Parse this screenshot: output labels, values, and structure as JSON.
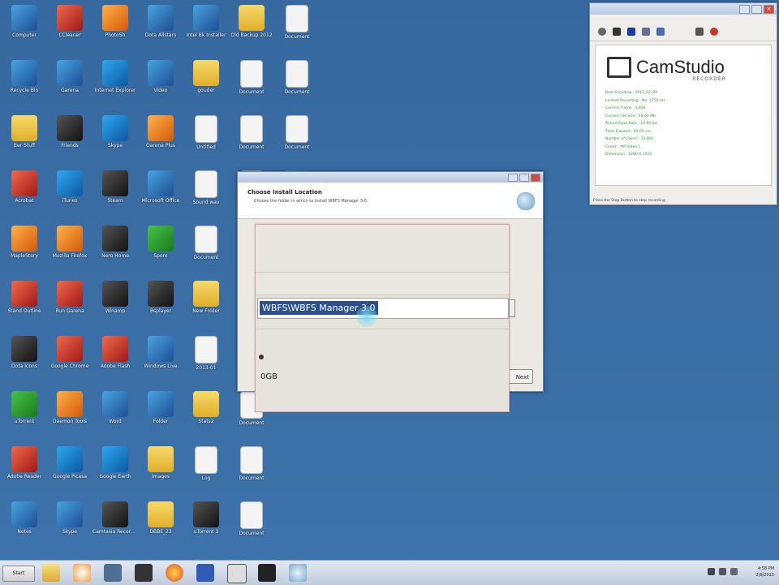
{
  "desktop": {
    "icons": [
      {
        "label": "Computer",
        "kind": "app"
      },
      {
        "label": "Recycle Bin",
        "kind": "app"
      },
      {
        "label": "Ber Stuff",
        "kind": "folder"
      },
      {
        "label": "Acrobat",
        "kind": "red"
      },
      {
        "label": "MapleStory",
        "kind": "orange"
      },
      {
        "label": "Stand Outline",
        "kind": "red"
      },
      {
        "label": "Dota Icons",
        "kind": "dark"
      },
      {
        "label": "uTorrent",
        "kind": "green"
      },
      {
        "label": "Adobe Reader",
        "kind": "red"
      },
      {
        "label": "Notes",
        "kind": "app"
      },
      {
        "label": "CCleaner",
        "kind": "red"
      },
      {
        "label": "Garena",
        "kind": "app"
      },
      {
        "label": "Friends",
        "kind": "dark"
      },
      {
        "label": "iTunes",
        "kind": "blue"
      },
      {
        "label": "Mozilla Firefox",
        "kind": "orange"
      },
      {
        "label": "Run Garena",
        "kind": "red"
      },
      {
        "label": "Google Chrome",
        "kind": "red"
      },
      {
        "label": "Daemon Tools",
        "kind": "orange"
      },
      {
        "label": "Google Picasa",
        "kind": "blue"
      },
      {
        "label": "Skype",
        "kind": "app"
      },
      {
        "label": "PhotoSh",
        "kind": "orange"
      },
      {
        "label": "Internet Explorer",
        "kind": "blue"
      },
      {
        "label": "Skype",
        "kind": "blue"
      },
      {
        "label": "Steam",
        "kind": "dark"
      },
      {
        "label": "Nero Home",
        "kind": "dark"
      },
      {
        "label": "Winamp",
        "kind": "dark"
      },
      {
        "label": "Adobe Flash",
        "kind": "red"
      },
      {
        "label": "Word",
        "kind": "app"
      },
      {
        "label": "Google Earth",
        "kind": "blue"
      },
      {
        "label": "Camtasia Recorder",
        "kind": "dark"
      },
      {
        "label": "Dota Allstars",
        "kind": "app"
      },
      {
        "label": "Video",
        "kind": "app"
      },
      {
        "label": "Garena Plus",
        "kind": "orange"
      },
      {
        "label": "Microsoft Office",
        "kind": "app"
      },
      {
        "label": "Spore",
        "kind": "green"
      },
      {
        "label": "Bsplayer",
        "kind": "dark"
      },
      {
        "label": "Windows Live",
        "kind": "app"
      },
      {
        "label": "Folder",
        "kind": "app"
      },
      {
        "label": "Images",
        "kind": "folder"
      },
      {
        "label": "DBBE_22",
        "kind": "folder"
      },
      {
        "label": "Intel Bk Installer",
        "kind": "app"
      },
      {
        "label": "gouder",
        "kind": "folder"
      },
      {
        "label": "Untitled",
        "kind": "doc"
      },
      {
        "label": "Sound.wav",
        "kind": "doc"
      },
      {
        "label": "Document",
        "kind": "doc"
      },
      {
        "label": "New Folder",
        "kind": "folder"
      },
      {
        "label": "2013-01",
        "kind": "doc"
      },
      {
        "label": "Stats2",
        "kind": "folder"
      },
      {
        "label": "Log",
        "kind": "doc"
      },
      {
        "label": "uTorrent 3",
        "kind": "dark"
      },
      {
        "label": "Old Backup 2012",
        "kind": "folder"
      },
      {
        "label": "Document",
        "kind": "doc"
      },
      {
        "label": "Document",
        "kind": "doc"
      },
      {
        "label": "Document",
        "kind": "doc"
      },
      {
        "label": "Document",
        "kind": "doc"
      },
      {
        "label": "Document",
        "kind": "doc"
      },
      {
        "label": "Document",
        "kind": "doc"
      },
      {
        "label": "Document",
        "kind": "doc"
      },
      {
        "label": "Document",
        "kind": "doc"
      },
      {
        "label": "Document",
        "kind": "doc"
      },
      {
        "label": "Document",
        "kind": "doc"
      },
      {
        "label": "Document",
        "kind": "doc"
      },
      {
        "label": "Document",
        "kind": "doc"
      },
      {
        "label": "WBFS Manager",
        "kind": "app"
      }
    ]
  },
  "camstudio": {
    "brand": "CamStudio",
    "tagline": "RECORDER",
    "stats": [
      "Best Encoding : 2013_02_09",
      "Limited Recording : No: 1750 ms",
      "Current Frame : 1,844",
      "Current File Size : 48.60 Mb",
      "Actual Input Rate : 19.80 fps",
      "Time Elapsed : 00:05 sec",
      "Number of Colors : 32 Bits",
      "Codec : MP Video 1",
      "Dimension : 1280 X 1024"
    ],
    "status": "Press the Stop Button to stop recording"
  },
  "installer": {
    "header_title": "Choose Install Location",
    "header_subtitle": "Choose the folder in which to install WBFS Manager 3.0.",
    "next_label": "Next"
  },
  "zoom": {
    "selected_path": "WBFS\\WBFS Manager 3.0",
    "space_label": "0GB"
  },
  "taskbar": {
    "start_label": "Start",
    "clock_time": "4:58 PM",
    "clock_date": "2/9/2013"
  },
  "colors": {
    "desktop": "#3a6ea5",
    "selection": "#2e4f8f",
    "stat_text": "#2e9a2e"
  }
}
